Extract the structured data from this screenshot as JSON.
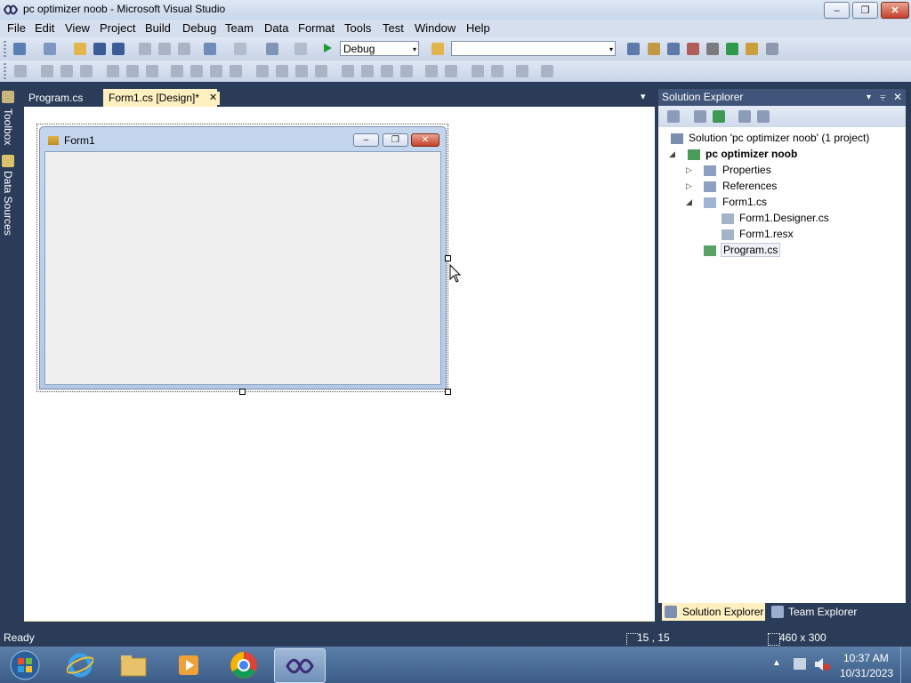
{
  "window": {
    "title": "pc optimizer noob - Microsoft Visual Studio",
    "minimize_glyph": "–",
    "restore_glyph": "❐",
    "close_glyph": "✕"
  },
  "menu": [
    "File",
    "Edit",
    "View",
    "Project",
    "Build",
    "Debug",
    "Team",
    "Data",
    "Format",
    "Tools",
    "Test",
    "Window",
    "Help"
  ],
  "toolbar": {
    "configuration": "Debug",
    "platform": "",
    "dropdown_arrow": "▾"
  },
  "left_tabs": {
    "toolbox": "Toolbox",
    "data_sources": "Data Sources"
  },
  "document_tabs": [
    {
      "label": "Program.cs",
      "active": false
    },
    {
      "label": "Form1.cs [Design]*",
      "active": true,
      "close_glyph": "✕"
    }
  ],
  "tab_overflow_glyph": "▾",
  "designer": {
    "form_title": "Form1"
  },
  "solution_explorer": {
    "title": "Solution Explorer",
    "pin_glyph": "▾",
    "dock_glyph": "⫧",
    "close_glyph": "✕",
    "tree": {
      "solution": "Solution 'pc optimizer noob' (1 project)",
      "project": "pc optimizer noob",
      "properties": "Properties",
      "references": "References",
      "form1": "Form1.cs",
      "designer": "Form1.Designer.cs",
      "resx": "Form1.resx",
      "program": "Program.cs"
    },
    "expanded_glyph": "◢",
    "collapsed_glyph": "▷",
    "bottom_tabs": [
      "Solution Explorer",
      "Team Explorer"
    ]
  },
  "status": {
    "text": "Ready",
    "position": "15 , 15",
    "size": "460 x 300"
  },
  "taskbar": {
    "time": "10:37 AM",
    "date": "10/31/2023",
    "tray_arrow": "▲"
  },
  "colors": {
    "vs_chrome": "#2b3c59",
    "active_tab": "#fff0c2",
    "taskbar": "#3b5c87"
  }
}
